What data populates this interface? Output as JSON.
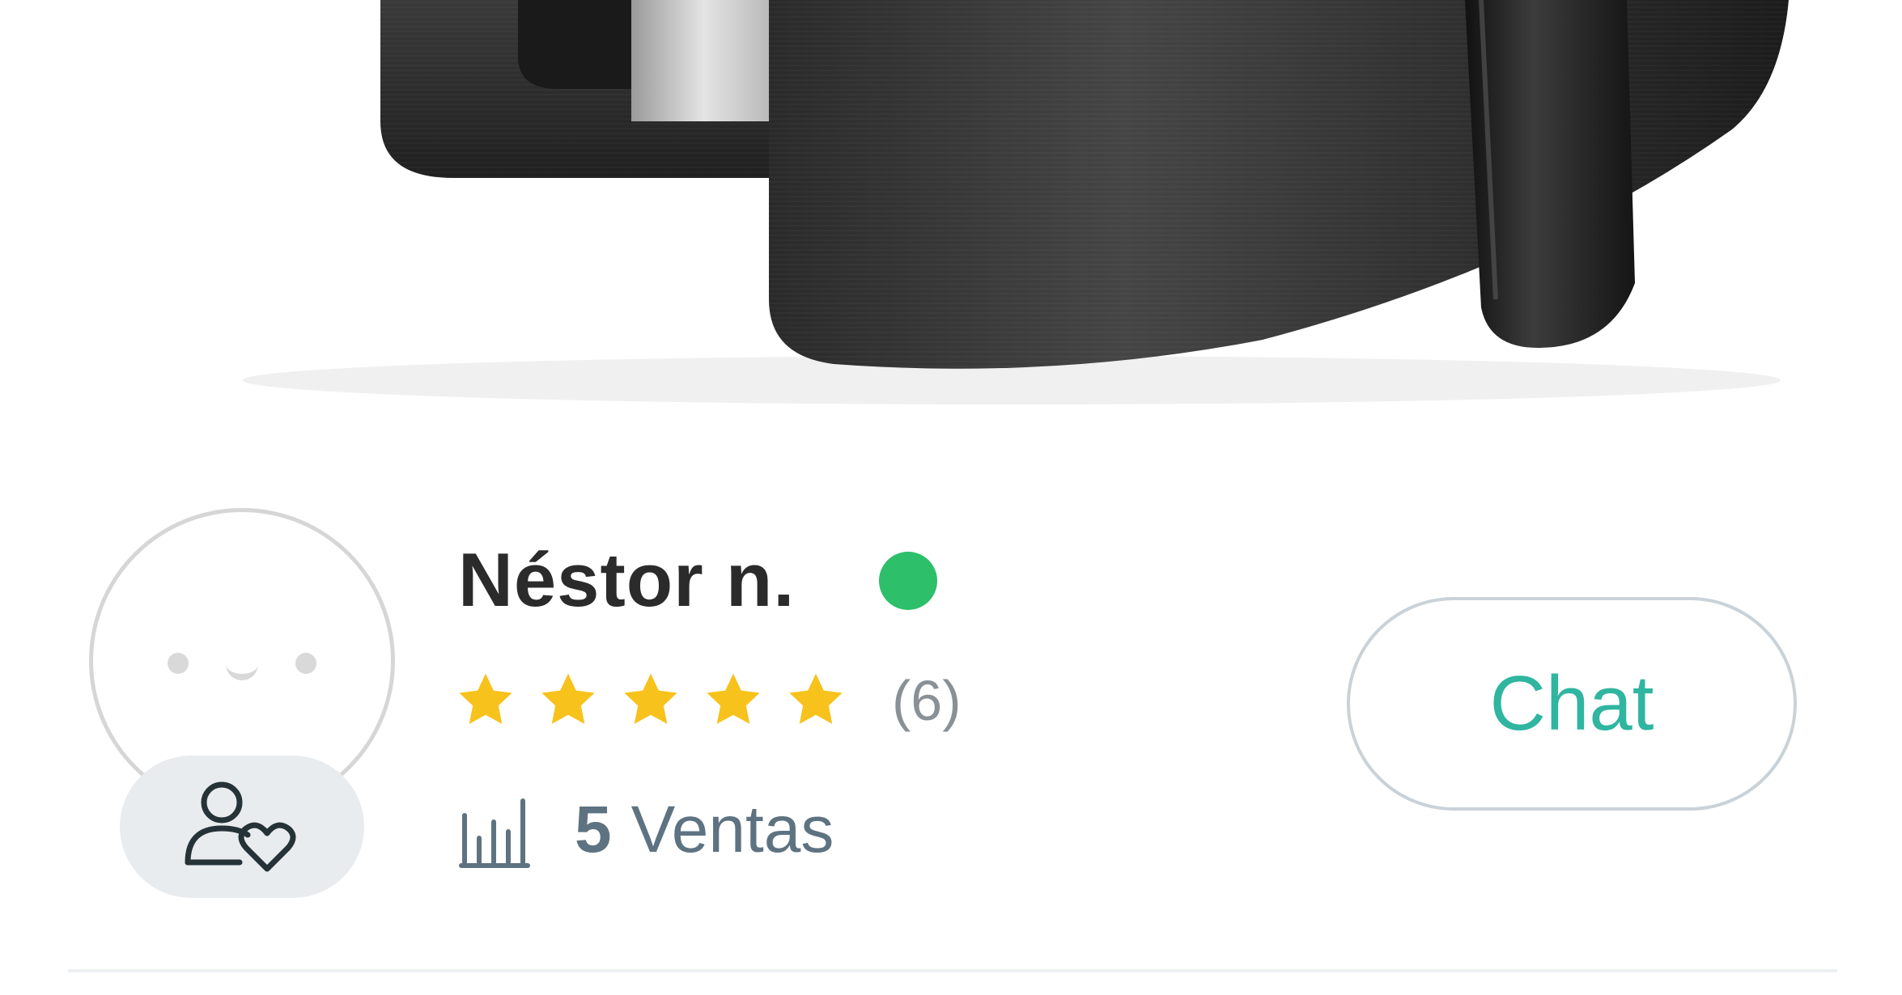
{
  "product": {
    "image_icon": "air-fryer-photo"
  },
  "seller": {
    "name": "Néstor n.",
    "online": true,
    "online_color": "#2dbf6a",
    "avatar_icon": "placeholder-face-avatar",
    "follow_icon": "user-heart-icon",
    "rating": {
      "stars": 5,
      "max_stars": 5,
      "star_color": "#f7c21b",
      "count_label": "(6)"
    },
    "sales": {
      "icon": "bar-chart-icon",
      "count": "5",
      "label": "Ventas"
    }
  },
  "actions": {
    "chat_label": "Chat",
    "chat_color": "#2fb5a0"
  }
}
